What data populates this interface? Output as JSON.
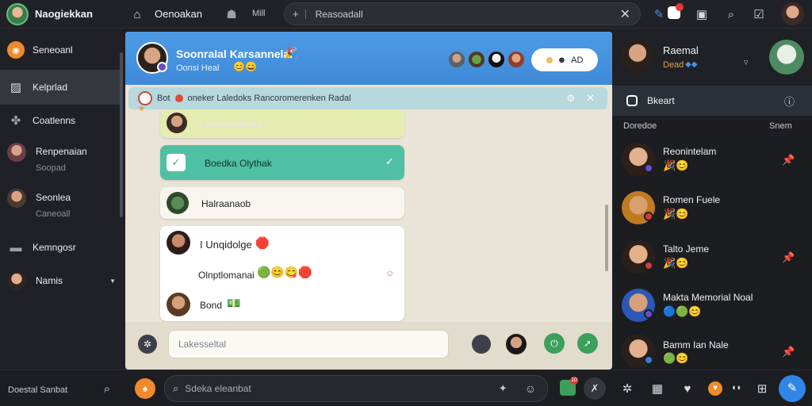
{
  "topbar": {
    "app_name": "Naogiekkan",
    "nav_label": "Oenoakan",
    "nav_extra": "Mill",
    "search_value": "Reasoadall",
    "search_prefix": "+"
  },
  "sidebar": {
    "items": [
      {
        "label": "Seneoanl",
        "sub": ""
      },
      {
        "label": "Kelprlad",
        "sub": ""
      },
      {
        "label": "Coatlenns",
        "sub": ""
      },
      {
        "label": "Renpenaian",
        "sub": "Soopad"
      },
      {
        "label": "Seonlea",
        "sub": "Caneoall"
      },
      {
        "label": "Kemngosr",
        "sub": ""
      },
      {
        "label": "Namis",
        "sub": ""
      }
    ],
    "footer_label": "Doestal Sanbat"
  },
  "chat": {
    "title": "Soonralal Karsannelal",
    "subtitle": "Oonsi Heal",
    "status_pill": "AD",
    "pinned_text": "Bot",
    "pinned_detail": "oneker Laledoks Rancoromerenken Radal",
    "messages": [
      {
        "text": "Lalrolandbieka"
      },
      {
        "text": "Boedka Olythak"
      },
      {
        "text": "Halraanaob"
      },
      {
        "text": "I Unqidolge"
      },
      {
        "text": "Olnptlomanai"
      },
      {
        "text": "Bond"
      }
    ],
    "composer_placeholder": "Lakesseltal"
  },
  "right": {
    "profile_name": "Raemal",
    "profile_sub": "Dead",
    "section_title": "Bkeart",
    "list_header_left": "Doredoe",
    "list_header_right": "Snem",
    "contacts": [
      {
        "name": "Reonintelam"
      },
      {
        "name": "Romen Fuele"
      },
      {
        "name": "Talto Jeme"
      },
      {
        "name": "Makta Memorial Noal"
      },
      {
        "name": "Bamm Ian Nale"
      }
    ]
  },
  "bottombar": {
    "search_placeholder": "Sdeka eleanbat",
    "badge_count": "10"
  },
  "colors": {
    "accent_blue": "#3f8ad8",
    "bubble_green": "#e4ecb0",
    "bubble_teal": "#4fc0a4",
    "badge_red": "#e53935"
  }
}
